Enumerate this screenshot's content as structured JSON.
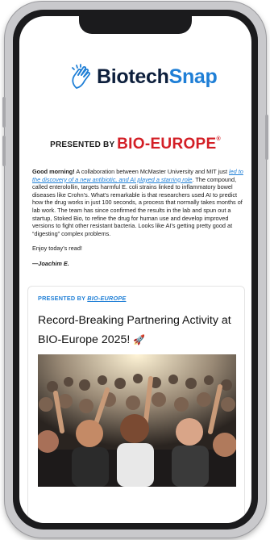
{
  "newsletter": {
    "brand_part1": "Biotech",
    "brand_part2": "Snap",
    "presented_by_label": "PRESENTED BY",
    "sponsor_name": "BIO-EUROPE",
    "sponsor_reg": "®"
  },
  "intro": {
    "greeting": "Good morning!",
    "text1": " A collaboration between McMaster University and MIT just ",
    "link_text": "led to the discovery of a new antibiotic, and AI played a starring role",
    "text2": ". The compound, called enterolollin, targets harmful E. coli strains linked to inflammatory bowel diseases like Crohn’s. What’s remarkable is that researchers used AI to predict how the drug works in just 100 seconds, a process that normally takes months of lab work. The team has since confirmed the results in the lab and spun out a startup, Stoked Bio, to refine the drug for human use and develop improved versions to fight other resistant bacteria. Looks like AI’s getting pretty good at “digesting” complex problems.",
    "closing": "Enjoy today’s read!",
    "signature": "—Joachim E."
  },
  "card": {
    "tag_prefix": "PRESENTED BY ",
    "tag_link": "BIO-EUROPE",
    "title": "Record-Breaking Partnering Activity at BIO-Europe 2025!",
    "title_icon": "rocket-icon"
  },
  "colors": {
    "brand_dark": "#0d1f3c",
    "brand_blue": "#1f7fd6",
    "sponsor_red": "#d31f26"
  }
}
